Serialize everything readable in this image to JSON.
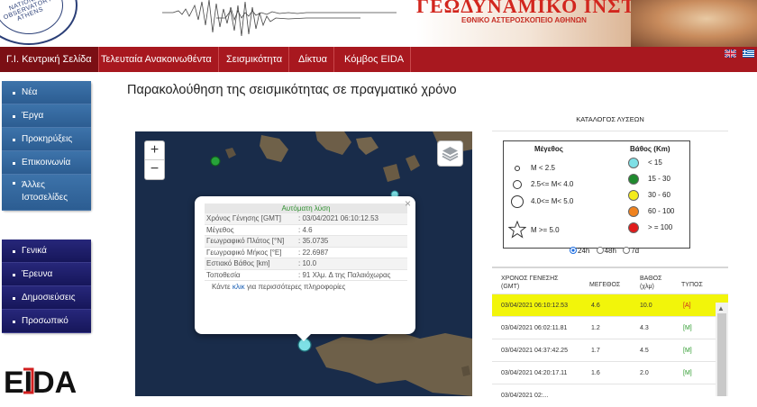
{
  "header": {
    "logo_text": "NATIONAL OBSERVATORY ATHENS",
    "title": "ΓΕΩΔΥΝΑΜΙΚΟ ΙΝΣΤΙΤΟΥΤΟ",
    "subtitle": "ΕΘΝΙΚΟ ΑΣΤΕΡΟΣΚΟΠΕΙΟ ΑΘΗΝΩΝ"
  },
  "nav": {
    "items": [
      {
        "label": "Γ.Ι. Κεντρική Σελίδα",
        "active": true
      },
      {
        "label": "Τελευταία Ανακοινωθέντα",
        "active": false
      },
      {
        "label": "Σεισμικότητα",
        "active": false
      },
      {
        "label": "Δίκτυα",
        "active": false
      },
      {
        "label": "Κόμβος EIDA",
        "active": false
      }
    ],
    "languages": [
      "english-flag-icon",
      "greek-flag-icon"
    ]
  },
  "sidebar_top": {
    "items": [
      {
        "label": "Νέα"
      },
      {
        "label": "Έργα"
      },
      {
        "label": "Προκηρύξεις"
      },
      {
        "label": "Επικοινωνία"
      },
      {
        "label": "Άλλες Ιστοσελίδες"
      }
    ]
  },
  "sidebar_bottom": {
    "items": [
      {
        "label": "Γενικά"
      },
      {
        "label": "Έρευνα"
      },
      {
        "label": "Δημοσιεύσεις"
      },
      {
        "label": "Προσωπικό"
      }
    ]
  },
  "eida_logo": "EIDA",
  "page_title": "Παρακολούθηση της σεισμικότητας σε πραγματικό χρόνο",
  "map": {
    "zoom_in": "+",
    "zoom_out": "−",
    "layers_icon": "layers-icon",
    "popup": {
      "header": "Αυτόματη λύση",
      "close": "×",
      "rows": [
        {
          "label": "Χρόνος Γένησης [GMT]",
          "value": ": 03/04/2021 06:10:12.53"
        },
        {
          "label": "Μέγεθος",
          "value": ": 4.6"
        },
        {
          "label": "Γεωγραφικό Πλάτος [°N]",
          "value": ": 35.0735"
        },
        {
          "label": "Γεωγραφικό Μήκος [°E]",
          "value": ": 22.6987"
        },
        {
          "label": "Εστιακό Βάθος [km]",
          "value": ": 10.0"
        },
        {
          "label": "Τοποθεσία",
          "value": ": 91 Χλμ. Δ της Παλαιόχωρας"
        }
      ],
      "more_prefix": "Κάντε ",
      "more_link": "κλικ",
      "more_suffix": " για περισσότερες πληροφορίες"
    }
  },
  "catalog": {
    "title": "ΚΑΤΑΛΟΓΟΣ ΛΥΣΕΩΝ",
    "legend": {
      "magnitude_title": "Μέγεθος",
      "depth_title": "Βάθος (Km)",
      "magnitudes": [
        "M < 2.5",
        "2.5<= M< 4.0",
        "4.0<= M< 5.0",
        "M >= 5.0"
      ],
      "depths": [
        {
          "label": "< 15",
          "color": "#7ee0e6"
        },
        {
          "label": "15 - 30",
          "color": "#1f8a2e"
        },
        {
          "label": "30 - 60",
          "color": "#f4ec1c"
        },
        {
          "label": "60 - 100",
          "color": "#f0821e"
        },
        {
          "label": "> = 100",
          "color": "#e01b1b"
        }
      ]
    },
    "periods": [
      {
        "label": "24h",
        "selected": true
      },
      {
        "label": "48h",
        "selected": false
      },
      {
        "label": "7d",
        "selected": false
      }
    ],
    "table": {
      "headers": {
        "time": "ΧΡΟΝΟΣ ΓΕΝΕΣΗΣ (GMT)",
        "magnitude": "ΜΕΓΕΘΟΣ",
        "depth": "ΒΑΘΟΣ (χλμ)",
        "type": "ΤΥΠΟΣ"
      },
      "rows": [
        {
          "time": "03/04/2021 06:10:12.53",
          "magnitude": "4.6",
          "depth": "10.0",
          "type": "[A]",
          "highlight": true
        },
        {
          "time": "03/04/2021 06:02:11.81",
          "magnitude": "1.2",
          "depth": "4.3",
          "type": "[M]",
          "highlight": false
        },
        {
          "time": "03/04/2021 04:37:42.25",
          "magnitude": "1.7",
          "depth": "4.5",
          "type": "[M]",
          "highlight": false
        },
        {
          "time": "03/04/2021 04:20:17.11",
          "magnitude": "1.6",
          "depth": "2.0",
          "type": "[M]",
          "highlight": false
        },
        {
          "time": "03/04/2021 02:...",
          "magnitude": "",
          "depth": "",
          "type": "",
          "highlight": false
        }
      ]
    }
  }
}
